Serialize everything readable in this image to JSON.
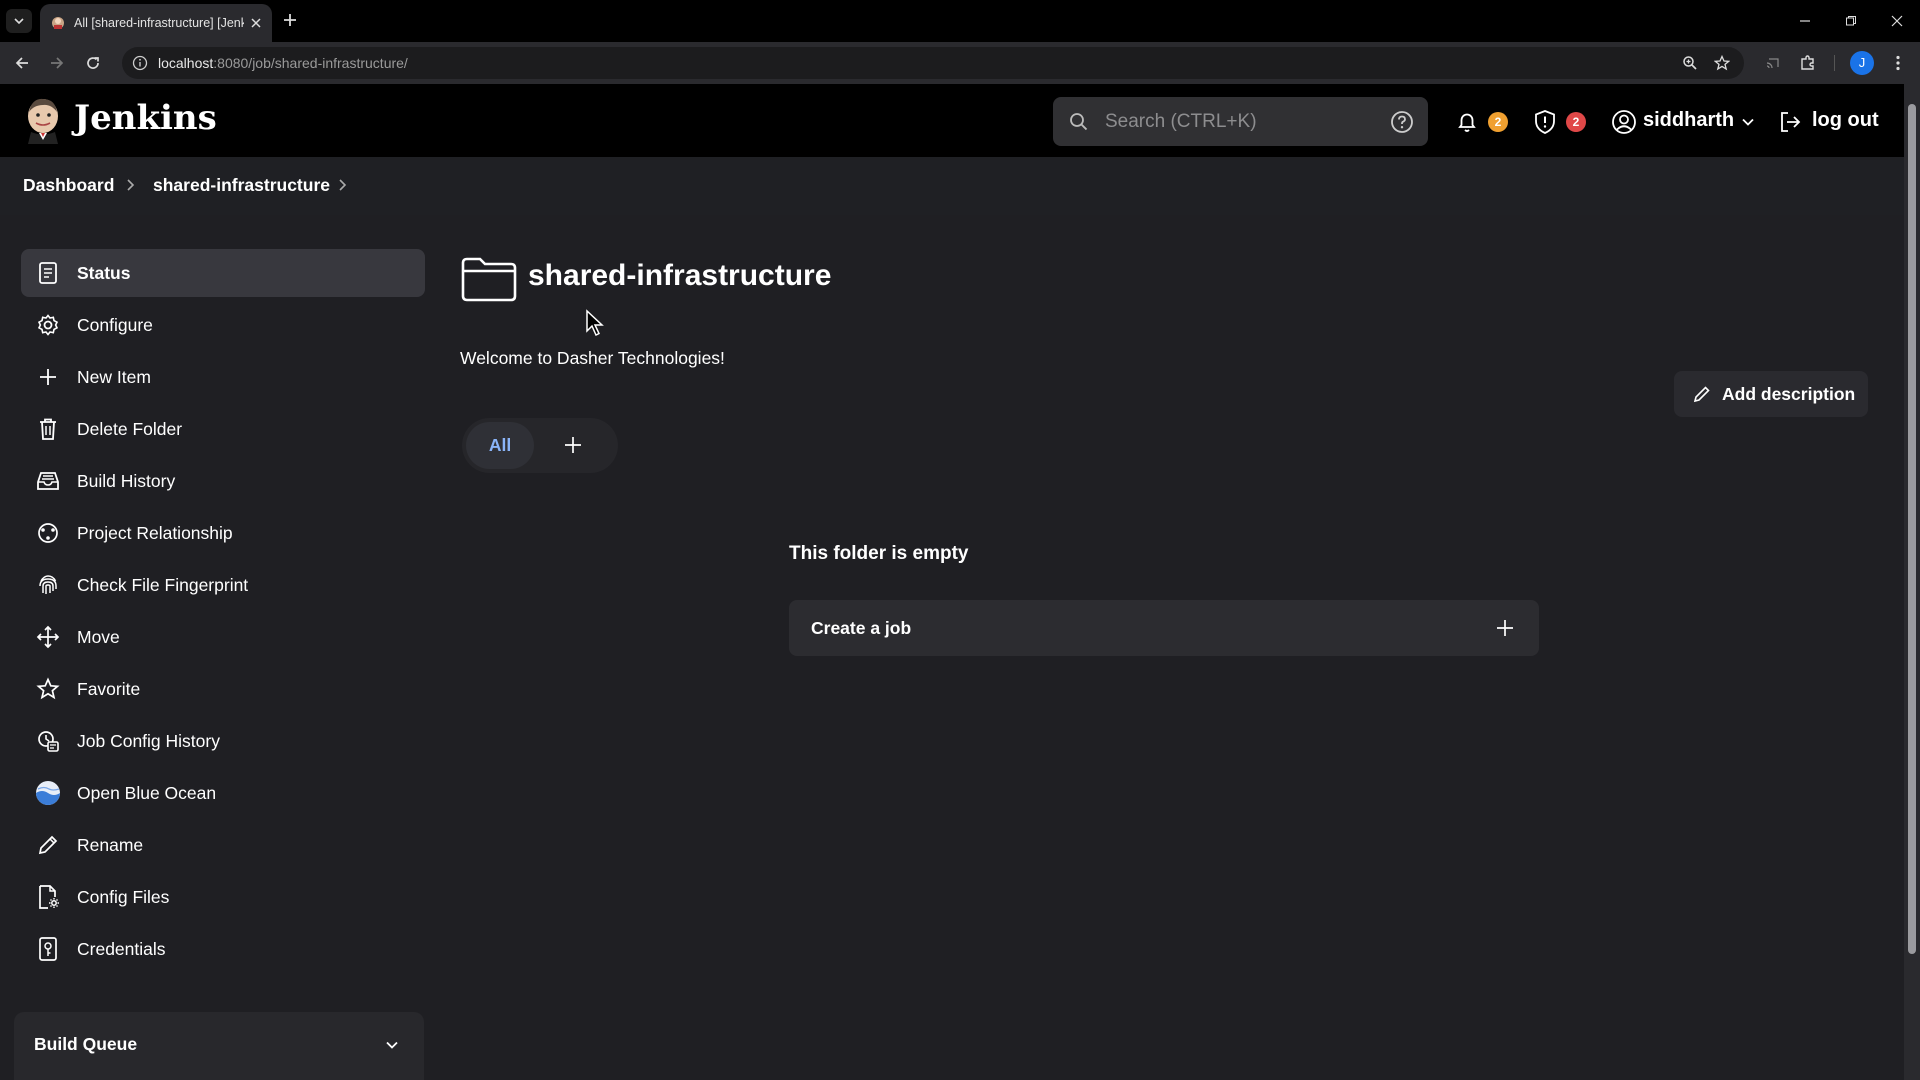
{
  "browser": {
    "tab_title": "All [shared-infrastructure] [Jenkins]",
    "url_host": "localhost",
    "url_path": ":8080/job/shared-infrastructure/",
    "profile_initial": "J"
  },
  "header": {
    "brand": "Jenkins",
    "search_placeholder": "Search (CTRL+K)",
    "notifications_count": "2",
    "security_count": "2",
    "username": "siddharth",
    "logout_label": "log out"
  },
  "breadcrumb": {
    "items": [
      "Dashboard",
      "shared-infrastructure"
    ]
  },
  "sidebar": {
    "items": [
      {
        "label": "Status",
        "icon": "status-icon"
      },
      {
        "label": "Configure",
        "icon": "gear-icon"
      },
      {
        "label": "New Item",
        "icon": "plus-icon"
      },
      {
        "label": "Delete Folder",
        "icon": "trash-icon"
      },
      {
        "label": "Build History",
        "icon": "inbox-icon"
      },
      {
        "label": "Project Relationship",
        "icon": "relationship-icon"
      },
      {
        "label": "Check File Fingerprint",
        "icon": "fingerprint-icon"
      },
      {
        "label": "Move",
        "icon": "move-icon"
      },
      {
        "label": "Favorite",
        "icon": "star-icon"
      },
      {
        "label": "Job Config History",
        "icon": "config-history-icon"
      },
      {
        "label": "Open Blue Ocean",
        "icon": "blue-ocean-icon"
      },
      {
        "label": "Rename",
        "icon": "pencil-icon"
      },
      {
        "label": "Config Files",
        "icon": "config-files-icon"
      },
      {
        "label": "Credentials",
        "icon": "credentials-icon"
      }
    ],
    "build_queue_label": "Build Queue"
  },
  "main": {
    "title": "shared-infrastructure",
    "description": "Welcome to Dasher Technologies!",
    "add_description_label": "Add description",
    "view_tabs": [
      "All"
    ],
    "empty_title": "This folder is empty",
    "create_job_label": "Create a job"
  },
  "colors": {
    "header_bg": "#000000",
    "page_bg": "#1f1f23",
    "active_item_bg": "#38383e",
    "tab_active_text": "#8ab4f8",
    "notification_badge": "#f0a030",
    "security_badge": "#e04848"
  }
}
